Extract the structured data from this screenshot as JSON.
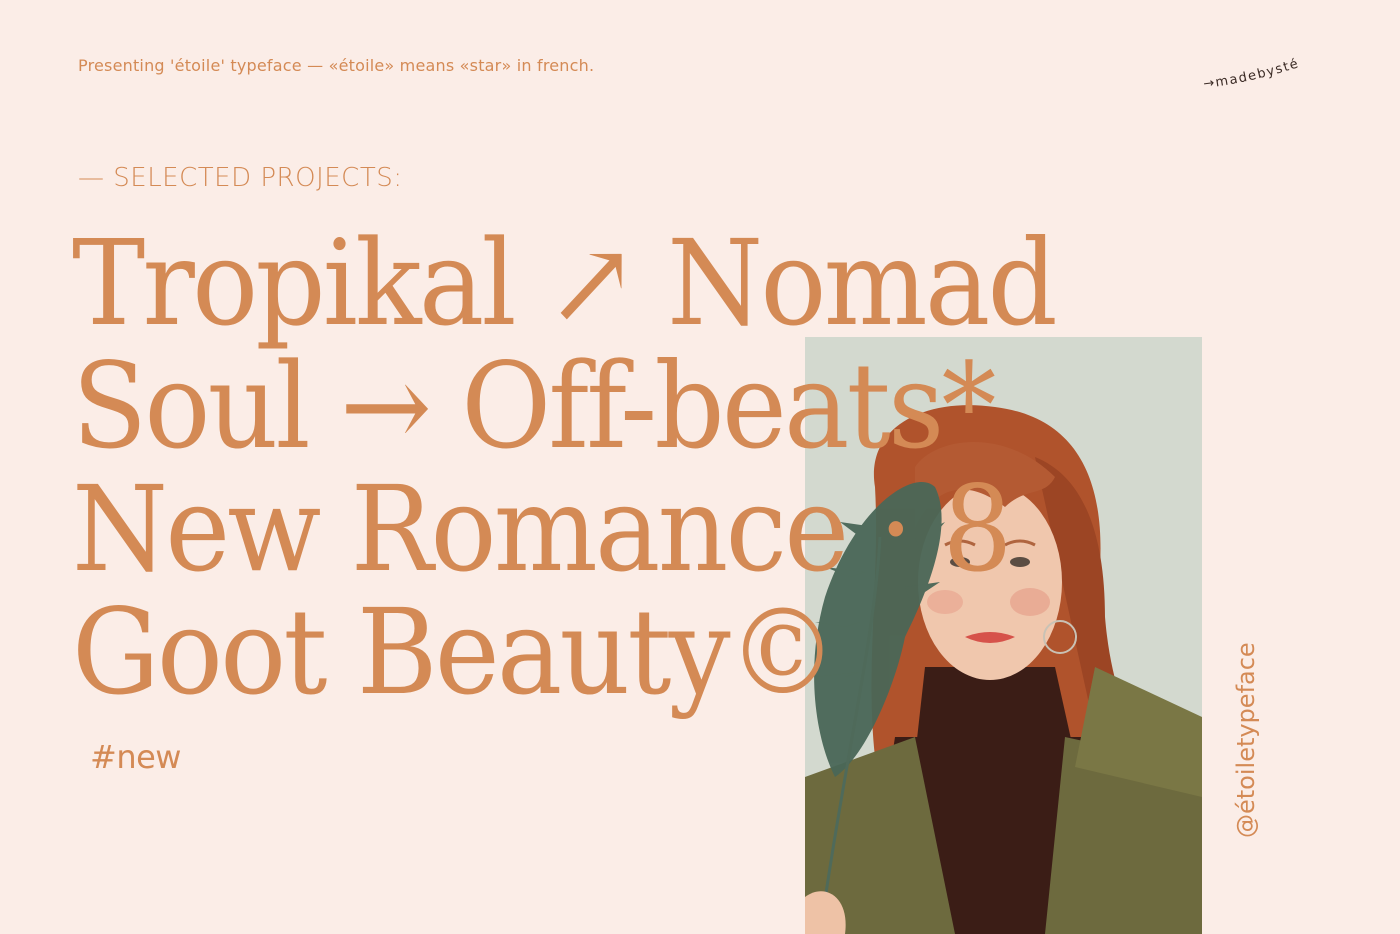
{
  "intro": "Presenting 'étoile' typeface —  «étoile» means «star» in french.",
  "brand": {
    "text": "→madebysté",
    "color": "#3a2a24"
  },
  "section_label": "— SELECTED PROJECTS:",
  "headline": {
    "lines": [
      "Tropikal ↗ Nomad",
      "Soul → Off-beats*",
      "New Romance · 8",
      "Goot Beauty©"
    ]
  },
  "tag": "#new",
  "handle": "@étoiletypeface",
  "colors": {
    "background": "#fbede7",
    "accent": "#d48a55"
  },
  "photo": {
    "subject": "portrait-photo"
  }
}
